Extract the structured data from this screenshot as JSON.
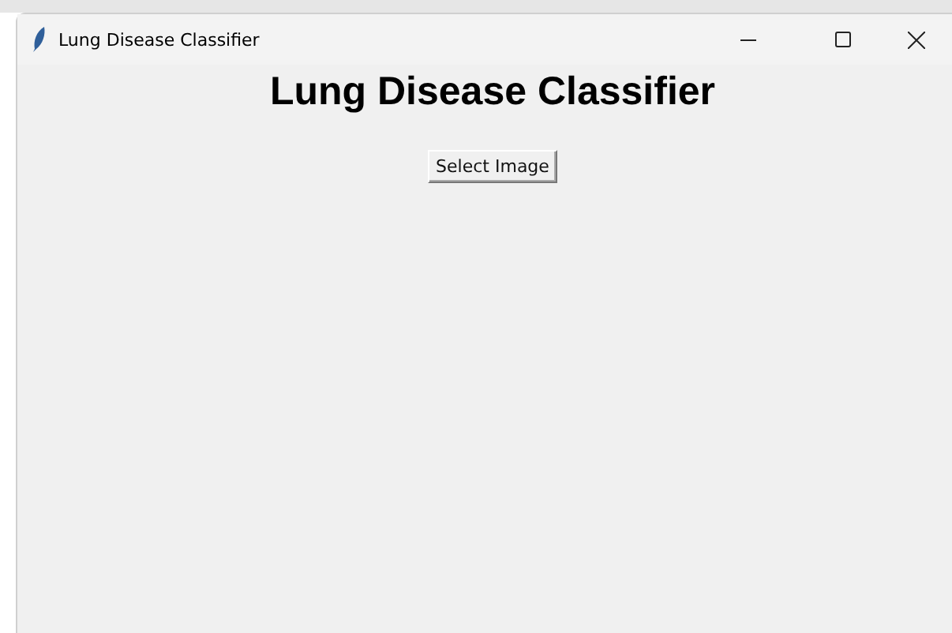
{
  "window": {
    "title": "Lung Disease Classifier"
  },
  "heading": "Lung Disease Classifier",
  "buttons": [
    "Select Image"
  ]
}
